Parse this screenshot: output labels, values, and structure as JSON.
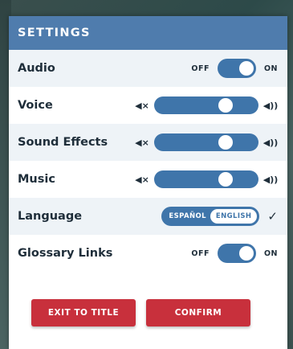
{
  "settings": {
    "title": "SETTINGS",
    "audio": {
      "label": "Audio",
      "off_label": "OFF",
      "on_label": "ON",
      "state": "on"
    },
    "voice": {
      "label": "Voice",
      "level": 0.72
    },
    "sound_effects": {
      "label": "Sound Effects",
      "level": 0.72
    },
    "music": {
      "label": "Music",
      "level": 0.72
    },
    "language": {
      "label": "Language",
      "options": [
        "ESPAÑOL",
        "ENGLISH"
      ],
      "selected": "ENGLISH",
      "check_icon": "✓"
    },
    "glossary_links": {
      "label": "Glossary Links",
      "off_label": "OFF",
      "on_label": "ON",
      "state": "on"
    },
    "mute_icon": "◀×",
    "volume_icon": "◀))"
  },
  "buttons": {
    "exit_to_title": "EXIT TO TITLE",
    "confirm": "CONFIRM"
  },
  "colors": {
    "header": "#4f7cad",
    "control": "#3f75aa",
    "button": "#c8303c",
    "shaded_row": "#eef3f7"
  }
}
